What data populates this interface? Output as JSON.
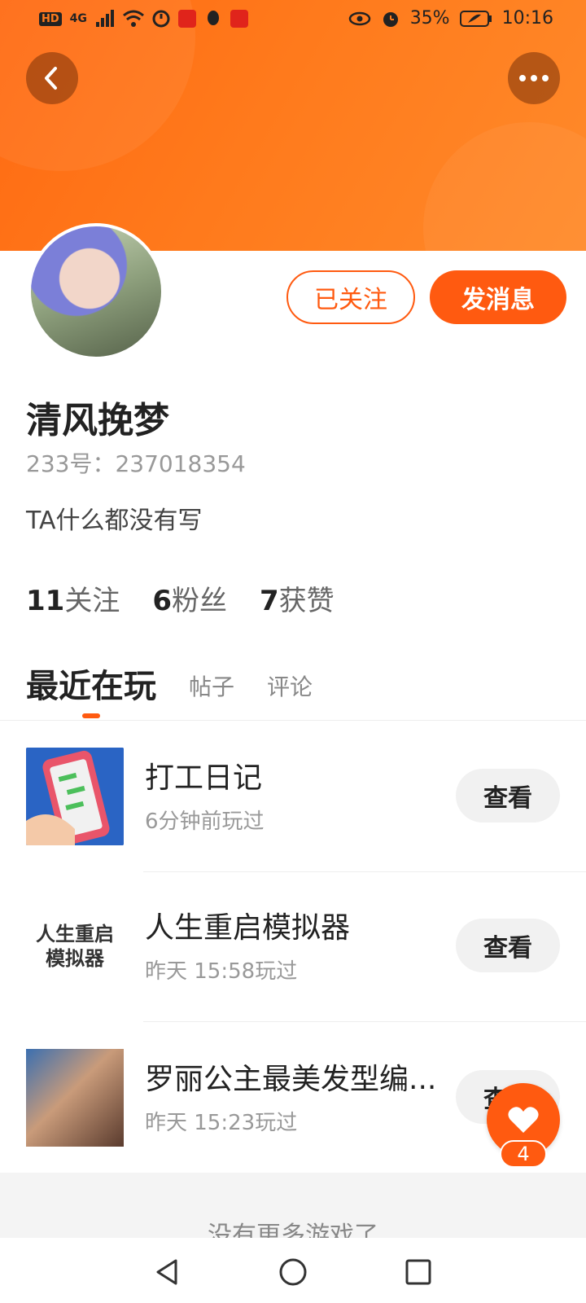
{
  "status_bar": {
    "battery": "35%",
    "time": "10:16",
    "network": "4G",
    "hd": "HD"
  },
  "header": {
    "back_icon": "chevron-left-icon",
    "more_icon": "more-dots-icon",
    "colors": {
      "gradient_start": "#ff6a12",
      "gradient_end": "#ff8a2a"
    }
  },
  "profile": {
    "name": "清风挽梦",
    "id_text": "233号：237018354",
    "bio": "TA什么都没有写",
    "follow_button": "已关注",
    "message_button": "发消息",
    "stats": [
      {
        "num": "11",
        "label": "关注"
      },
      {
        "num": "6",
        "label": "粉丝"
      },
      {
        "num": "7",
        "label": "获赞"
      }
    ]
  },
  "tabs": {
    "active": "最近在玩",
    "items": [
      "帖子",
      "评论"
    ]
  },
  "games": [
    {
      "name": "打工日记",
      "time": "6分钟前玩过",
      "button": "查看",
      "thumb_text": ""
    },
    {
      "name": "人生重启模拟器",
      "time": "昨天 15:58玩过",
      "button": "查看",
      "thumb_text_1": "人生重启",
      "thumb_text_2": "模拟器"
    },
    {
      "name": "罗丽公主最美发型编...",
      "time": "昨天 15:23玩过",
      "button": "查看"
    }
  ],
  "footer": {
    "no_more": "没有更多游戏了"
  },
  "like_fab": {
    "count": "4",
    "icon": "heart-icon"
  },
  "accent_color": "#ff5a10"
}
